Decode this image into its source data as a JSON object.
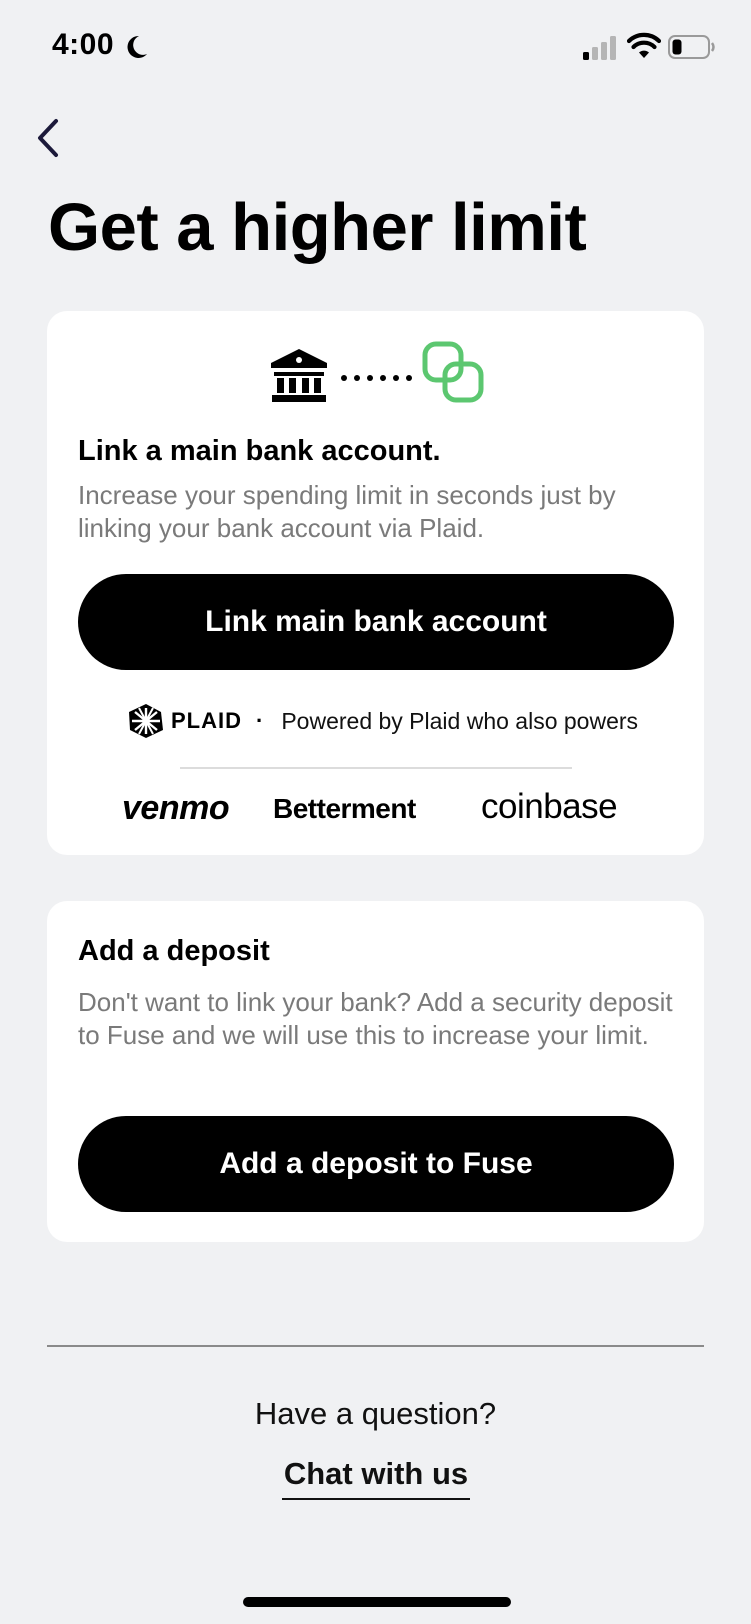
{
  "status_bar": {
    "time": "4:00",
    "icons": [
      "moon-icon",
      "signal-icon",
      "wifi-icon",
      "battery-icon"
    ]
  },
  "nav": {
    "back_icon": "chevron-left-icon"
  },
  "page": {
    "title": "Get a higher limit"
  },
  "link_card": {
    "illustration_icons": [
      "bank-icon",
      "dots-connector",
      "fuse-logo-icon"
    ],
    "title": "Link a main bank account.",
    "description": "Increase your spending limit in seconds just by linking your bank account via Plaid.",
    "button_label": "Link main bank account",
    "plaid": {
      "wordmark": "PLAID",
      "separator": "·",
      "powered_text": "Powered by Plaid who also powers"
    },
    "partners": [
      "venmo",
      "Betterment",
      "coinbase"
    ]
  },
  "deposit_card": {
    "title": "Add a deposit",
    "description": "Don't want to link your bank? Add a security deposit to Fuse and we will use this to increase your limit.",
    "button_label": "Add a deposit to Fuse"
  },
  "footer": {
    "question": "Have a question?",
    "chat_link": "Chat with us"
  },
  "colors": {
    "background": "#f0f1f3",
    "card": "#ffffff",
    "button": "#000000",
    "muted_text": "#7a7a7a",
    "accent_green": "#5cc770"
  }
}
